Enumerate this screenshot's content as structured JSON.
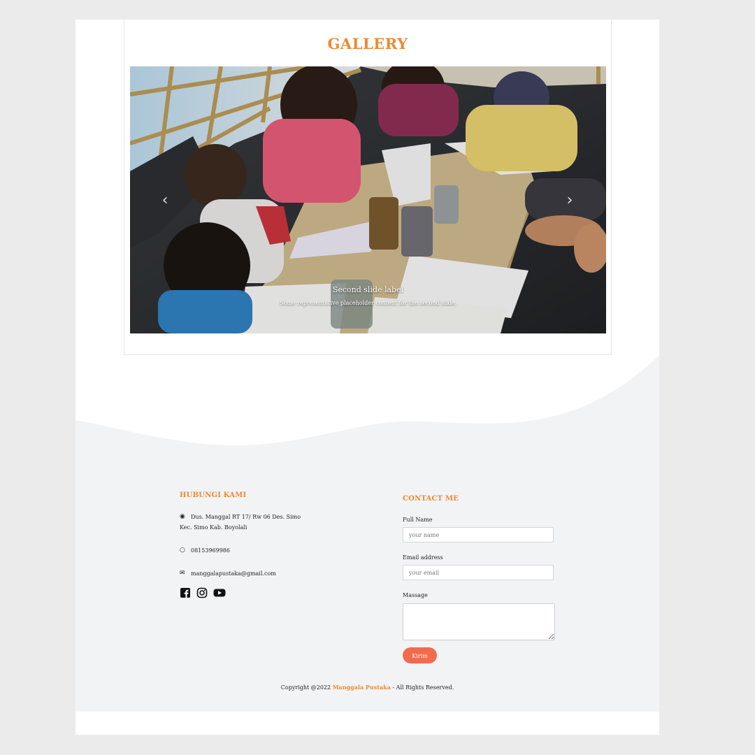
{
  "gallery": {
    "title": "GALLERY",
    "slide": {
      "label": "Second slide label",
      "text": "Some representative placeholder content for the second slide."
    },
    "prev_icon": "chevron-left",
    "next_icon": "chevron-right"
  },
  "contact_info": {
    "heading": "HUBUNGI KAMI",
    "address_line1": "Dus. Manggal RT 17/ Rw 06 Des. Simo",
    "address_line2": "Kec. Simo Kab. Boyolali",
    "phone": "08153969986",
    "email": "manggalapustaka@gmail.com",
    "socials": [
      "facebook",
      "instagram",
      "youtube"
    ]
  },
  "contact_form": {
    "heading": "CONTACT ME",
    "name_label": "Full Name",
    "name_placeholder": "your name",
    "email_label": "Email address",
    "email_placeholder": "your email",
    "message_label": "Massage",
    "submit_label": "Kirim"
  },
  "footer": {
    "copyright_prefix": "Copyright @2022 ",
    "brand": "Manggala Pustaka",
    "copyright_suffix": " - All Rights Reserved."
  },
  "colors": {
    "accent": "#ec8a33",
    "button": "#f26b4d",
    "footer_bg": "#f2f3f4",
    "page_bg": "#ecebeb"
  }
}
